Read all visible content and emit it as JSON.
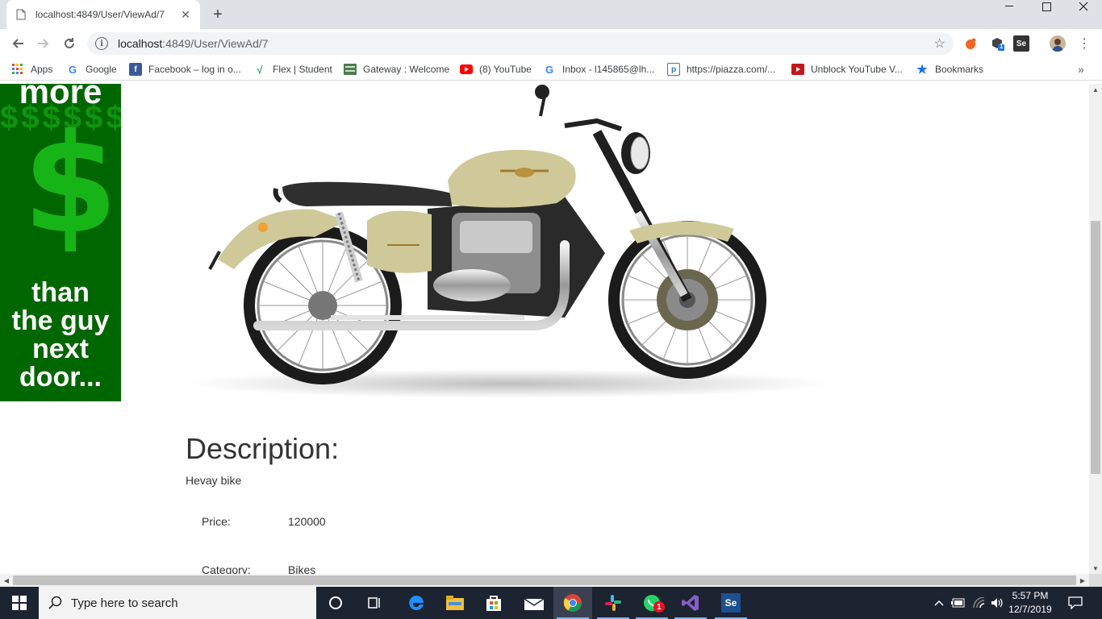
{
  "browser": {
    "tab_title": "localhost:4849/User/ViewAd/7",
    "url_host": "localhost",
    "url_rest": ":4849/User/ViewAd/7",
    "bookmarks": [
      {
        "label": "Apps",
        "icon": "apps-grid-icon"
      },
      {
        "label": "Google",
        "icon": "google-icon"
      },
      {
        "label": "Facebook – log in o...",
        "icon": "facebook-icon"
      },
      {
        "label": "Flex | Student",
        "icon": "flex-icon"
      },
      {
        "label": "Gateway : Welcome",
        "icon": "gateway-icon"
      },
      {
        "label": "(8) YouTube",
        "icon": "youtube-icon"
      },
      {
        "label": "Inbox - l145865@lh...",
        "icon": "google-icon"
      },
      {
        "label": "https://piazza.com/...",
        "icon": "piazza-icon"
      },
      {
        "label": "Unblock YouTube V...",
        "icon": "unblock-youtube-icon"
      },
      {
        "label": "Bookmarks",
        "icon": "star-icon"
      }
    ],
    "extension_badge": "1",
    "ext_se_label": "Se"
  },
  "ad": {
    "top_text": "more",
    "bottom_text_1": "than",
    "bottom_text_2": "the guy",
    "bottom_text_3": "next",
    "bottom_text_4": "door..."
  },
  "listing": {
    "description_heading": "Description:",
    "description_text": "Hevay bike",
    "price_label": "Price:",
    "price_value": "120000",
    "category_label": "Category:",
    "category_value": "Bikes",
    "bike_color": "#cfc99a"
  },
  "taskbar": {
    "search_placeholder": "Type here to search",
    "time": "5:57 PM",
    "date": "12/7/2019",
    "whatsapp_badge": "1",
    "se_label": "Se"
  }
}
